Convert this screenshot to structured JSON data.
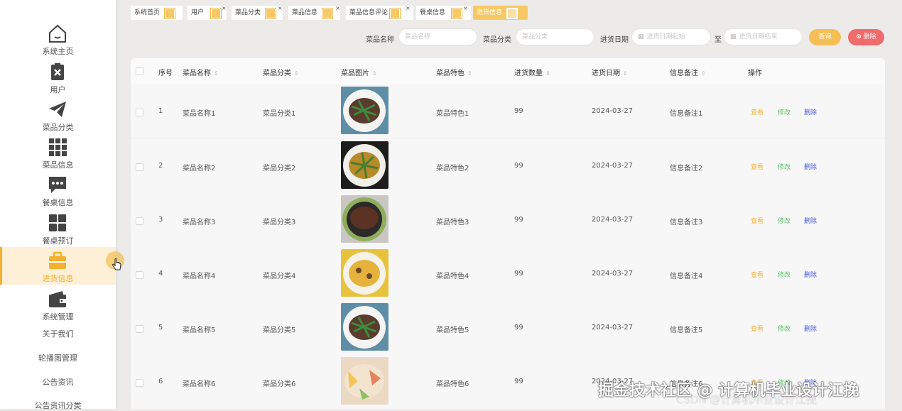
{
  "sidebar": {
    "items": [
      {
        "label": "系统主页",
        "icon": "home-icon"
      },
      {
        "label": "用户",
        "icon": "user-clipboard-icon"
      },
      {
        "label": "菜品分类",
        "icon": "paper-plane-icon"
      },
      {
        "label": "菜品信息",
        "icon": "grid-icon"
      },
      {
        "label": "餐桌信息",
        "icon": "chat-bubble-icon"
      },
      {
        "label": "餐桌预订",
        "icon": "four-squares-icon"
      },
      {
        "label": "进货信息",
        "icon": "briefcase-icon",
        "active": true
      },
      {
        "label": "系统管理",
        "icon": "wallet-icon"
      }
    ],
    "links": [
      "关于我们",
      "轮播图管理",
      "公告资讯",
      "公告资讯分类"
    ]
  },
  "tabs": [
    {
      "label": "系统首页",
      "closable": false
    },
    {
      "label": "用户",
      "closable": true
    },
    {
      "label": "菜品分类",
      "closable": true
    },
    {
      "label": "菜品信息",
      "closable": true
    },
    {
      "label": "菜品信息评论",
      "closable": true
    },
    {
      "label": "餐桌信息",
      "closable": true
    },
    {
      "label": "进货信息",
      "closable": false,
      "active": true
    }
  ],
  "search": {
    "name_label": "菜品名称",
    "name_placeholder": "菜品名称",
    "category_label": "菜品分类",
    "category_placeholder": "菜品分类",
    "date_label": "进货日期",
    "date_start_placeholder": "进货日期起始",
    "date_sep": "至",
    "date_end_placeholder": "进货日期结束",
    "search_button": "查询",
    "delete_button": "删除"
  },
  "table": {
    "headers": [
      "序号",
      "菜品名称",
      "菜品分类",
      "菜品图片",
      "菜品特色",
      "进货数量",
      "进货日期",
      "信息备注",
      "操作"
    ],
    "actions": {
      "view": "查看",
      "edit": "修改",
      "delete": "删除"
    },
    "rows": [
      {
        "index": "1",
        "name": "菜品名称1",
        "category": "菜品分类1",
        "feature": "菜品特色1",
        "qty": "99",
        "date": "2024-03-27",
        "note": "信息备注1"
      },
      {
        "index": "2",
        "name": "菜品名称2",
        "category": "菜品分类2",
        "feature": "菜品特色2",
        "qty": "99",
        "date": "2024-03-27",
        "note": "信息备注2"
      },
      {
        "index": "3",
        "name": "菜品名称3",
        "category": "菜品分类3",
        "feature": "菜品特色3",
        "qty": "99",
        "date": "2024-03-27",
        "note": "信息备注3"
      },
      {
        "index": "4",
        "name": "菜品名称4",
        "category": "菜品分类4",
        "feature": "菜品特色4",
        "qty": "99",
        "date": "2024-03-27",
        "note": "信息备注4"
      },
      {
        "index": "5",
        "name": "菜品名称5",
        "category": "菜品分类5",
        "feature": "菜品特色5",
        "qty": "99",
        "date": "2024-03-27",
        "note": "信息备注5"
      },
      {
        "index": "6",
        "name": "菜品名称6",
        "category": "菜品分类6",
        "feature": "菜品特色6",
        "qty": "99",
        "date": "2024-03-27",
        "note": "信息备注6"
      }
    ]
  },
  "watermark": {
    "main": "掘金技术社区 @ 计算机毕业设计江挽",
    "sub": "CSDN @计算机毕业设计江挽"
  },
  "colors": {
    "accent": "#f4b030",
    "danger": "#f06b6b",
    "edit": "#5fbf6a",
    "delete_link": "#4b5ad8"
  }
}
